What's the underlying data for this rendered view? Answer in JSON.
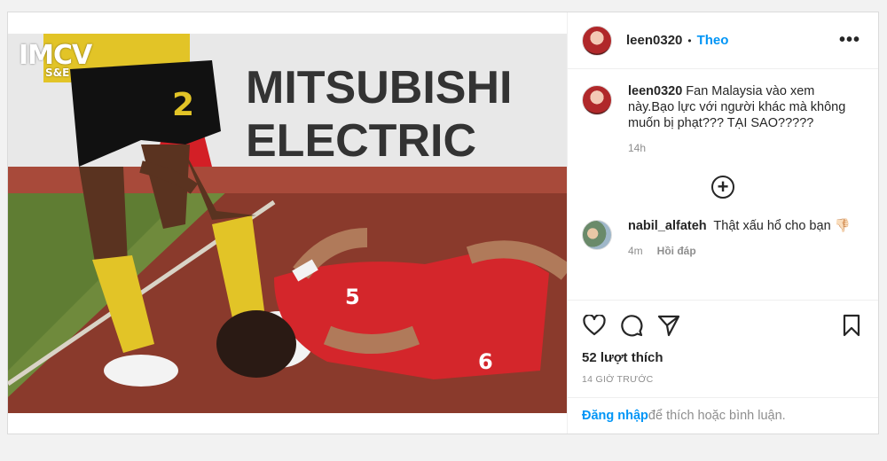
{
  "post": {
    "author": "leen0320",
    "dot": "•",
    "follow_label": "Theo",
    "more_label": "•••"
  },
  "photo": {
    "watermark_main": "IMCV",
    "watermark_sub": "S&E",
    "banner_line1": "MITSUBISHI",
    "banner_line2": "ELECTRIC",
    "jersey_number_yellow": "2",
    "jersey_number_red": "5",
    "jersey_number_red_back": "6"
  },
  "caption": {
    "user": "leen0320",
    "text": "Fan Malaysia vào xem này.Bạo lực với người khác mà không muốn bị phạt??? TẠI SAO?????",
    "time": "14h"
  },
  "load_more_label": "+",
  "comments": [
    {
      "user": "nabil_alfateh",
      "text": "Thật xấu hổ cho bạn 👎🏻",
      "time": "4m",
      "reply_label": "Hồi đáp"
    }
  ],
  "icons": {
    "like": "heart-icon",
    "comment": "comment-icon",
    "share": "share-icon",
    "save": "bookmark-icon"
  },
  "likes_label": "52 lượt thích",
  "time_ago": "14 GIỜ TRƯỚC",
  "login": {
    "link": "Đăng nhập",
    "rest": "để thích hoặc bình luận."
  },
  "colors": {
    "accent": "#0095f6",
    "text": "#262626",
    "muted": "#8e8e8e"
  }
}
